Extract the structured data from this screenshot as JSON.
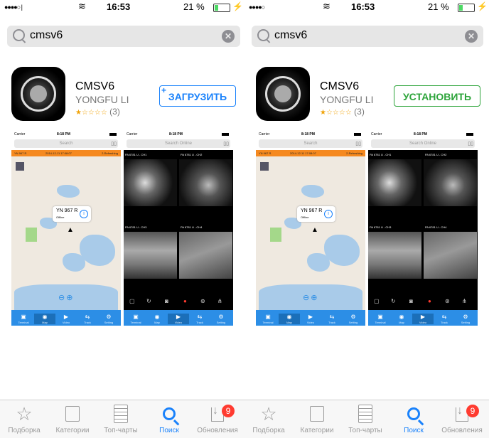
{
  "panels": [
    {
      "status": {
        "time": "16:53",
        "battery": "21 %"
      },
      "search": {
        "query": "cmsv6"
      },
      "app": {
        "name": "CMSV6",
        "developer": "YONGFU LI",
        "stars": "★☆☆☆☆",
        "reviews": "(3)",
        "action": "ЗАГРУЗИТЬ",
        "action_prefix": "+"
      },
      "shots": {
        "map": {
          "carrier": "Carrier",
          "time": "8:18 PM",
          "search": "Search",
          "bar_left": "YN 967 R",
          "bar_mid": "2014-12-11 17:08:07",
          "bar_right": "2-Refreshing",
          "popup_name": "YN 967 R",
          "popup_status": "Offline",
          "tabs": [
            "Terminal",
            "Map",
            "Video",
            "Track",
            "Setting"
          ]
        },
        "video": {
          "carrier": "Carrier",
          "time": "8:18 PM",
          "search": "Search Online",
          "cams": [
            "PA 6781 U - CH1",
            "PA 6781 U - CH2",
            "PA 6781 U - CH3",
            "PA 6781 U - CH4"
          ],
          "tabs": [
            "Terminal",
            "Map",
            "Video",
            "Track",
            "Setting"
          ]
        }
      },
      "tabbar": {
        "items": [
          "Подборка",
          "Категории",
          "Топ-чарты",
          "Поиск",
          "Обновления"
        ],
        "badge": "9"
      }
    },
    {
      "status": {
        "time": "16:53",
        "battery": "21 %"
      },
      "search": {
        "query": "cmsv6"
      },
      "app": {
        "name": "CMSV6",
        "developer": "YONGFU LI",
        "stars": "★☆☆☆☆",
        "reviews": "(3)",
        "action": "УСТАНОВИТЬ"
      },
      "shots": {
        "map": {
          "carrier": "Carrier",
          "time": "8:18 PM",
          "search": "Search",
          "bar_left": "YN 967 R",
          "bar_mid": "2014-12-11 17:08:07",
          "bar_right": "2-Refreshing",
          "popup_name": "YN 967 R",
          "popup_status": "Offline",
          "tabs": [
            "Terminal",
            "Map",
            "Video",
            "Track",
            "Setting"
          ]
        },
        "video": {
          "carrier": "Carrier",
          "time": "8:18 PM",
          "search": "Search Online",
          "cams": [
            "PA 6781 U - CH1",
            "PA 6781 U - CH2",
            "PA 6781 U - CH3",
            "PA 6781 U - CH4"
          ],
          "tabs": [
            "Terminal",
            "Map",
            "Video",
            "Track",
            "Setting"
          ]
        }
      },
      "tabbar": {
        "items": [
          "Подборка",
          "Категории",
          "Топ-чарты",
          "Поиск",
          "Обновления"
        ],
        "badge": "9"
      }
    }
  ],
  "colors": {
    "accent_blue": "#1a82fb",
    "install_green": "#2da43a",
    "badge_red": "#ff3b30",
    "map_bar_orange": "#f5891f",
    "app_tab_blue": "#2c8ee6"
  },
  "icons": {
    "tabbar": [
      "star-icon",
      "categories-icon",
      "top-charts-icon",
      "search-icon",
      "updates-icon"
    ]
  }
}
